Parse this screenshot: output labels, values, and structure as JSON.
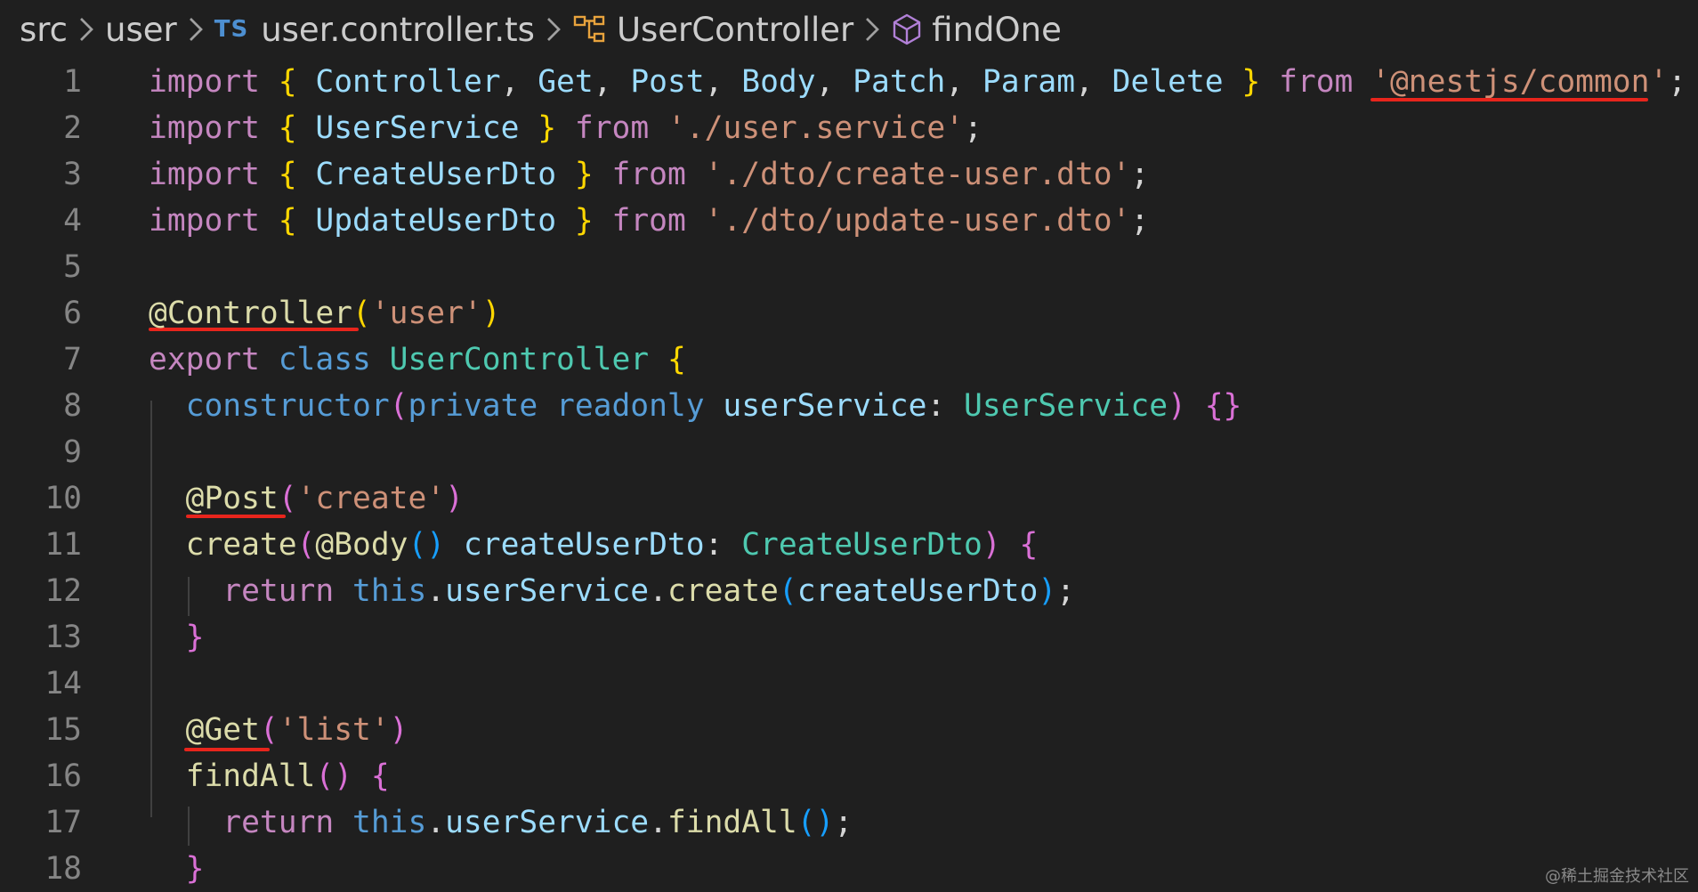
{
  "breadcrumb": {
    "items": [
      {
        "label": "src",
        "icon": "none"
      },
      {
        "label": "user",
        "icon": "none"
      },
      {
        "label": "user.controller.ts",
        "icon": "ts-file-icon",
        "badge": "TS"
      },
      {
        "label": "UserController",
        "icon": "class-symbol-icon"
      },
      {
        "label": "findOne",
        "icon": "method-cube-icon"
      }
    ]
  },
  "colors": {
    "background": "#1f1f1f",
    "keyword": "#c586c0",
    "storage": "#569cd6",
    "variable": "#9cdcfe",
    "type": "#4ec9b0",
    "function": "#dcdcaa",
    "string": "#ce9178",
    "punct": "#d4d4d4",
    "bracket_gold": "#ffd700",
    "bracket_pink": "#da70d6",
    "bracket_blue": "#179fff",
    "line_number": "#858585",
    "underline": "#e8251c"
  },
  "code_lines": [
    {
      "n": "1",
      "tokens": [
        {
          "t": "import",
          "c": "keyword"
        },
        {
          "t": " ",
          "c": "punct"
        },
        {
          "t": "{",
          "c": "bracket_gold"
        },
        {
          "t": " Controller",
          "c": "variable"
        },
        {
          "t": ",",
          "c": "punct"
        },
        {
          "t": " Get",
          "c": "variable"
        },
        {
          "t": ",",
          "c": "punct"
        },
        {
          "t": " Post",
          "c": "variable"
        },
        {
          "t": ",",
          "c": "punct"
        },
        {
          "t": " Body",
          "c": "variable"
        },
        {
          "t": ",",
          "c": "punct"
        },
        {
          "t": " Patch",
          "c": "variable"
        },
        {
          "t": ",",
          "c": "punct"
        },
        {
          "t": " Param",
          "c": "variable"
        },
        {
          "t": ",",
          "c": "punct"
        },
        {
          "t": " Delete",
          "c": "variable"
        },
        {
          "t": " ",
          "c": "punct"
        },
        {
          "t": "}",
          "c": "bracket_gold"
        },
        {
          "t": " from",
          "c": "keyword"
        },
        {
          "t": " ",
          "c": "punct"
        },
        {
          "t": "'@nestjs/common'",
          "c": "string"
        },
        {
          "t": ";",
          "c": "punct"
        }
      ]
    },
    {
      "n": "2",
      "tokens": [
        {
          "t": "import",
          "c": "keyword"
        },
        {
          "t": " ",
          "c": "punct"
        },
        {
          "t": "{",
          "c": "bracket_gold"
        },
        {
          "t": " UserService",
          "c": "variable"
        },
        {
          "t": " ",
          "c": "punct"
        },
        {
          "t": "}",
          "c": "bracket_gold"
        },
        {
          "t": " from",
          "c": "keyword"
        },
        {
          "t": " ",
          "c": "punct"
        },
        {
          "t": "'./user.service'",
          "c": "string"
        },
        {
          "t": ";",
          "c": "punct"
        }
      ]
    },
    {
      "n": "3",
      "tokens": [
        {
          "t": "import",
          "c": "keyword"
        },
        {
          "t": " ",
          "c": "punct"
        },
        {
          "t": "{",
          "c": "bracket_gold"
        },
        {
          "t": " CreateUserDto",
          "c": "variable"
        },
        {
          "t": " ",
          "c": "punct"
        },
        {
          "t": "}",
          "c": "bracket_gold"
        },
        {
          "t": " from",
          "c": "keyword"
        },
        {
          "t": " ",
          "c": "punct"
        },
        {
          "t": "'./dto/create-user.dto'",
          "c": "string"
        },
        {
          "t": ";",
          "c": "punct"
        }
      ]
    },
    {
      "n": "4",
      "tokens": [
        {
          "t": "import",
          "c": "keyword"
        },
        {
          "t": " ",
          "c": "punct"
        },
        {
          "t": "{",
          "c": "bracket_gold"
        },
        {
          "t": " UpdateUserDto",
          "c": "variable"
        },
        {
          "t": " ",
          "c": "punct"
        },
        {
          "t": "}",
          "c": "bracket_gold"
        },
        {
          "t": " from",
          "c": "keyword"
        },
        {
          "t": " ",
          "c": "punct"
        },
        {
          "t": "'./dto/update-user.dto'",
          "c": "string"
        },
        {
          "t": ";",
          "c": "punct"
        }
      ]
    },
    {
      "n": "5",
      "tokens": []
    },
    {
      "n": "6",
      "tokens": [
        {
          "t": "@Controller",
          "c": "function"
        },
        {
          "t": "(",
          "c": "bracket_gold"
        },
        {
          "t": "'user'",
          "c": "string"
        },
        {
          "t": ")",
          "c": "bracket_gold"
        }
      ]
    },
    {
      "n": "7",
      "tokens": [
        {
          "t": "export",
          "c": "keyword"
        },
        {
          "t": " class",
          "c": "storage"
        },
        {
          "t": " UserController",
          "c": "type"
        },
        {
          "t": " ",
          "c": "punct"
        },
        {
          "t": "{",
          "c": "bracket_gold"
        }
      ]
    },
    {
      "n": "8",
      "tokens": [
        {
          "t": "  constructor",
          "c": "storage"
        },
        {
          "t": "(",
          "c": "bracket_pink"
        },
        {
          "t": "private",
          "c": "storage"
        },
        {
          "t": " readonly",
          "c": "storage"
        },
        {
          "t": " userService",
          "c": "variable"
        },
        {
          "t": ":",
          "c": "punct"
        },
        {
          "t": " UserService",
          "c": "type"
        },
        {
          "t": ")",
          "c": "bracket_pink"
        },
        {
          "t": " ",
          "c": "punct"
        },
        {
          "t": "{}",
          "c": "bracket_pink"
        }
      ]
    },
    {
      "n": "9",
      "tokens": []
    },
    {
      "n": "10",
      "tokens": [
        {
          "t": "  @Post",
          "c": "function"
        },
        {
          "t": "(",
          "c": "bracket_pink"
        },
        {
          "t": "'create'",
          "c": "string"
        },
        {
          "t": ")",
          "c": "bracket_pink"
        }
      ]
    },
    {
      "n": "11",
      "tokens": [
        {
          "t": "  create",
          "c": "function"
        },
        {
          "t": "(",
          "c": "bracket_pink"
        },
        {
          "t": "@Body",
          "c": "function"
        },
        {
          "t": "()",
          "c": "bracket_blue"
        },
        {
          "t": " createUserDto",
          "c": "variable"
        },
        {
          "t": ":",
          "c": "punct"
        },
        {
          "t": " CreateUserDto",
          "c": "type"
        },
        {
          "t": ")",
          "c": "bracket_pink"
        },
        {
          "t": " ",
          "c": "punct"
        },
        {
          "t": "{",
          "c": "bracket_pink"
        }
      ]
    },
    {
      "n": "12",
      "tokens": [
        {
          "t": "    return",
          "c": "keyword"
        },
        {
          "t": " this",
          "c": "storage"
        },
        {
          "t": ".",
          "c": "punct"
        },
        {
          "t": "userService",
          "c": "variable"
        },
        {
          "t": ".",
          "c": "punct"
        },
        {
          "t": "create",
          "c": "function"
        },
        {
          "t": "(",
          "c": "bracket_blue"
        },
        {
          "t": "createUserDto",
          "c": "variable"
        },
        {
          "t": ")",
          "c": "bracket_blue"
        },
        {
          "t": ";",
          "c": "punct"
        }
      ]
    },
    {
      "n": "13",
      "tokens": [
        {
          "t": "  }",
          "c": "bracket_pink"
        }
      ]
    },
    {
      "n": "14",
      "tokens": []
    },
    {
      "n": "15",
      "tokens": [
        {
          "t": "  @Get",
          "c": "function"
        },
        {
          "t": "(",
          "c": "bracket_pink"
        },
        {
          "t": "'list'",
          "c": "string"
        },
        {
          "t": ")",
          "c": "bracket_pink"
        }
      ]
    },
    {
      "n": "16",
      "tokens": [
        {
          "t": "  findAll",
          "c": "function"
        },
        {
          "t": "()",
          "c": "bracket_pink"
        },
        {
          "t": " ",
          "c": "punct"
        },
        {
          "t": "{",
          "c": "bracket_pink"
        }
      ]
    },
    {
      "n": "17",
      "tokens": [
        {
          "t": "    return",
          "c": "keyword"
        },
        {
          "t": " this",
          "c": "storage"
        },
        {
          "t": ".",
          "c": "punct"
        },
        {
          "t": "userService",
          "c": "variable"
        },
        {
          "t": ".",
          "c": "punct"
        },
        {
          "t": "findAll",
          "c": "function"
        },
        {
          "t": "()",
          "c": "bracket_blue"
        },
        {
          "t": ";",
          "c": "punct"
        }
      ]
    },
    {
      "n": "18",
      "tokens": [
        {
          "t": "  }",
          "c": "bracket_pink"
        }
      ]
    }
  ],
  "watermark": "@稀土掘金技术社区"
}
